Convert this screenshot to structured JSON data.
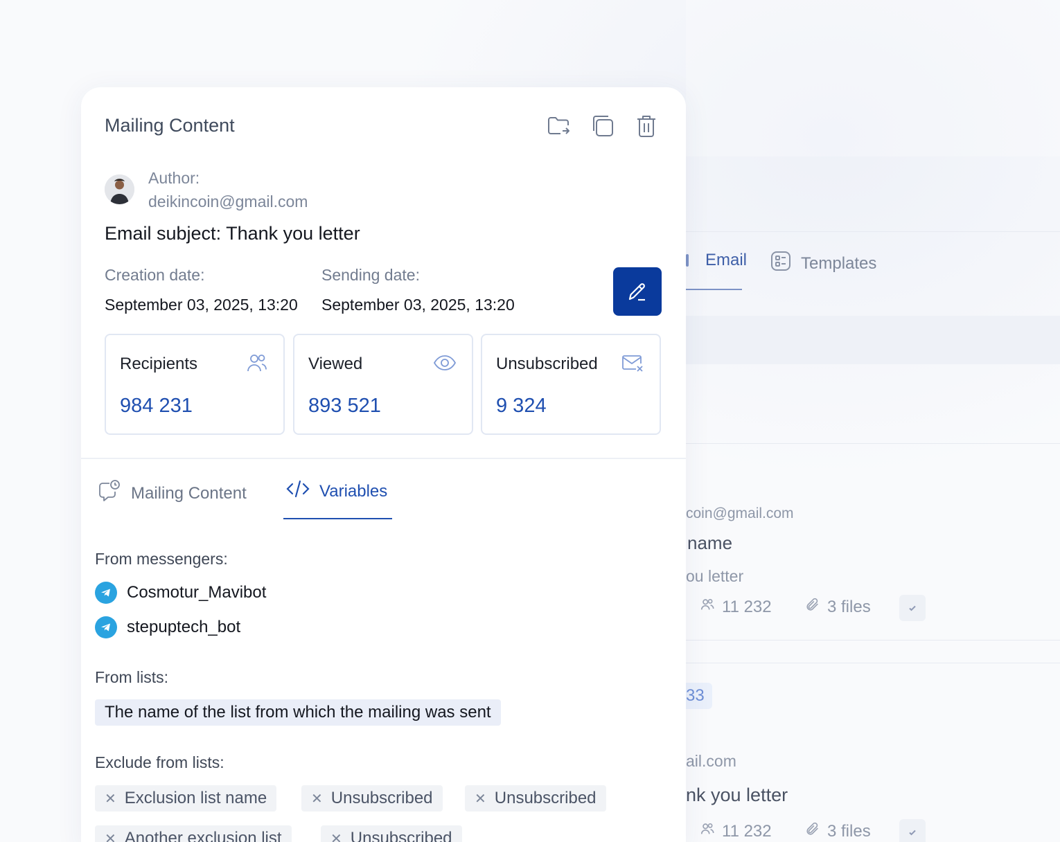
{
  "background": {
    "tabs": {
      "email": "Email",
      "templates": "Templates"
    },
    "row1": {
      "email": "coin@gmail.com",
      "name": "name",
      "subject": "ou letter",
      "recipients": "11 232",
      "files": "3 files"
    },
    "row2": {
      "badge": "33",
      "email": "ail.com",
      "subject": "nk you letter",
      "recipients": "11 232",
      "files": "3 files"
    }
  },
  "card": {
    "title": "Mailing Content",
    "author_label": "Author:",
    "author_email": "deikincoin@gmail.com",
    "email_subject": "Email subject: Thank you letter",
    "creation_label": "Creation date:",
    "creation_value": "September 03, 2025, 13:20",
    "sending_label": "Sending date:",
    "sending_value": "September 03, 2025, 13:20",
    "stats": [
      {
        "label": "Recipients",
        "value": "984 231",
        "icon": "users-icon"
      },
      {
        "label": "Viewed",
        "value": "893 521",
        "icon": "eye-icon"
      },
      {
        "label": "Unsubscribed",
        "value": "9 324",
        "icon": "mail-x-icon"
      }
    ],
    "tabs": {
      "content": "Mailing Content",
      "variables": "Variables"
    },
    "from_messengers_label": "From messengers:",
    "messengers": [
      "Cosmotur_Mavibot",
      "stepuptech_bot"
    ],
    "from_lists_label": "From lists:",
    "from_list": "The name of the list from which the mailing was sent",
    "exclude_label": "Exclude from lists:",
    "exclude": [
      "Exclusion list name",
      "Unsubscribed",
      "Unsubscribed",
      "Another exclusion list",
      "Unsubscribed"
    ]
  },
  "colors": {
    "accent": "#1f4fb0",
    "edit_button": "#0a3a9c",
    "telegram": "#2aa3e0"
  }
}
